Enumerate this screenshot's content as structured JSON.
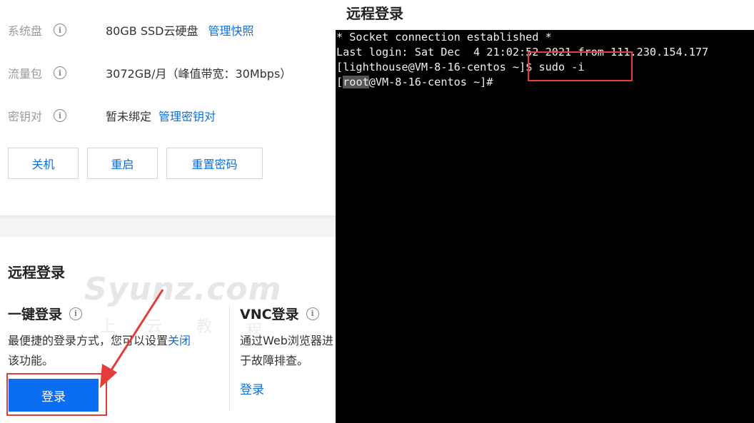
{
  "info": {
    "rows": [
      {
        "label": "系统盘",
        "value": "80GB SSD云硬盘",
        "link": "管理快照"
      },
      {
        "label": "流量包",
        "value": "3072GB/月（峰值带宽：30Mbps）",
        "link": ""
      },
      {
        "label": "密钥对",
        "value": "暂未绑定",
        "link": "管理密钥对"
      }
    ],
    "info_icon": "i"
  },
  "actions": {
    "shutdown": "关机",
    "restart": "重启",
    "reset_password": "重置密码"
  },
  "remote": {
    "section_title": "远程登录",
    "watermark": "Syunz.com",
    "watermark_chars": [
      "上",
      "云",
      "教",
      "程"
    ],
    "one_click": {
      "title": "一键登录",
      "desc_prefix": "最便捷的登录方式，您可以设置",
      "desc_link": "关闭",
      "desc_suffix": "该功能。",
      "button": "登录"
    },
    "vnc": {
      "title": "VNC登录",
      "desc_line1": "通过Web浏览器进",
      "desc_line2": "于故障排查。",
      "link": "登录"
    }
  },
  "terminal": {
    "title": "远程登录",
    "lines": {
      "l1": "* Socket connection established *",
      "l2": "Last login: Sat Dec  4 21:02:52 2021 from 111.230.154.177",
      "l3_prefix": "[lighthouse@VM-8-16-centos ",
      "l3_mid": "~]$ sudo -i",
      "l4_open": "[",
      "l4_user": "root",
      "l4_rest": "@VM-8-16-centos ~]#"
    }
  },
  "colors": {
    "link": "#0f6fd6",
    "primary_button": "#0a6ef5",
    "annotation_red": "#e63b3b",
    "terminal_bg": "#000000"
  }
}
